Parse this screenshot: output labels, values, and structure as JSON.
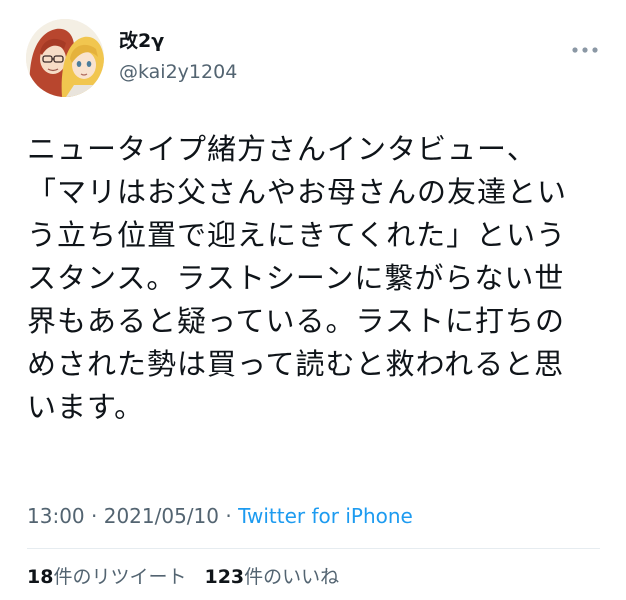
{
  "author": {
    "display_name": "改2γ",
    "handle": "@kai2y1204",
    "avatar_icon": "avatar-illustration"
  },
  "menu": {
    "more_icon": "more-dots-icon"
  },
  "tweet": {
    "lines": [
      "ニュータイプ緒方さんインタビュー、",
      "「マリはお父さんやお母さんの友達とい",
      "う立ち位置で迎えにきてくれた」という",
      "スタンス。ラストシーンに繋がらない世",
      "界もあると疑っている。ラストに打ちの",
      "めされた勢は買って読むと救われると思",
      "います。"
    ]
  },
  "meta": {
    "time": "13:00",
    "separator": " · ",
    "date": "2021/05/10",
    "source": "Twitter for iPhone"
  },
  "stats": {
    "retweets_count": "18",
    "retweets_label": "件のリツイート",
    "likes_count": "123",
    "likes_label": "件のいいね"
  },
  "colors": {
    "text": "#0f1419",
    "secondary": "#536471",
    "link": "#1d9bf0",
    "divider": "#e6ecf0"
  }
}
